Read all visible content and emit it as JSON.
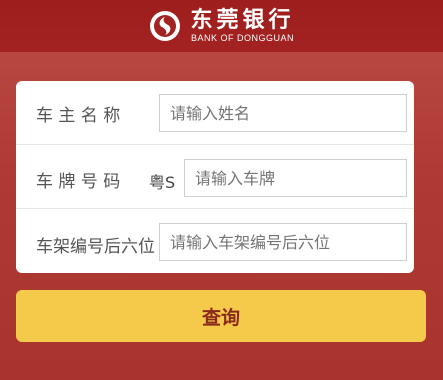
{
  "header": {
    "brand_cn": "东莞银行",
    "brand_en": "BANK OF DONGGUAN"
  },
  "form": {
    "owner_label": "车 主 名 称",
    "owner_placeholder": "请输入姓名",
    "plate_label": "车 牌 号 码",
    "plate_prefix": "粤S",
    "plate_placeholder": "请输入车牌",
    "vin_label": "车架编号后六位",
    "vin_placeholder": "请输入车架编号后六位"
  },
  "actions": {
    "query_label": "查询"
  },
  "colors": {
    "header_red": "#a32222",
    "button_yellow": "#f5c94a"
  }
}
